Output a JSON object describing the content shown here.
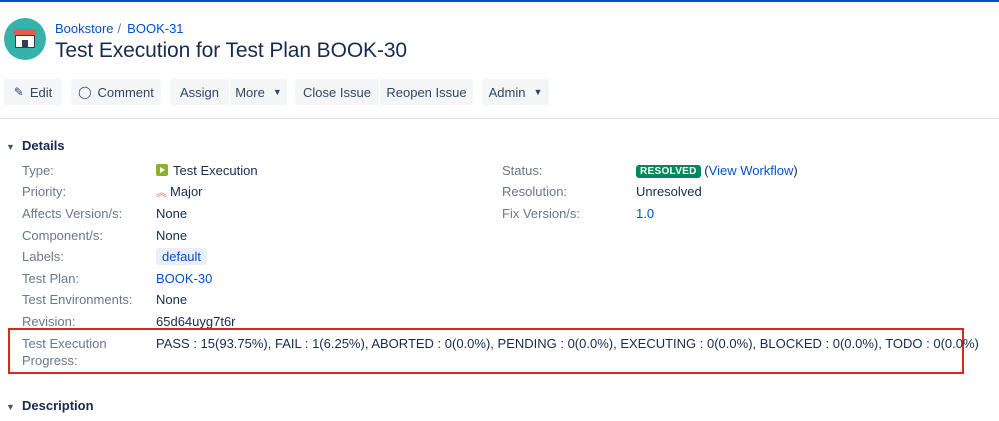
{
  "header": {
    "breadcrumb_project": "Bookstore",
    "breadcrumb_separator": "/",
    "breadcrumb_issue": "BOOK-31",
    "title": "Test Execution for Test Plan BOOK-30"
  },
  "toolbar": {
    "edit": "Edit",
    "comment": "Comment",
    "assign": "Assign",
    "more": "More",
    "close_issue": "Close Issue",
    "reopen_issue": "Reopen Issue",
    "admin": "Admin"
  },
  "details": {
    "heading": "Details",
    "left": [
      {
        "label": "Type:",
        "value": "Test Execution"
      },
      {
        "label": "Priority:",
        "value": "Major"
      },
      {
        "label": "Affects Version/s:",
        "value": "None"
      },
      {
        "label": "Component/s:",
        "value": "None"
      },
      {
        "label": "Labels:",
        "value": "default"
      },
      {
        "label": "Test Plan:",
        "value": "BOOK-30"
      },
      {
        "label": "Test Environments:",
        "value": "None"
      },
      {
        "label": "Revision:",
        "value": "65d64uyg7t6r"
      }
    ],
    "progress": {
      "label_line1": "Test Execution",
      "label_line2": "Progress:",
      "value": "PASS : 15(93.75%), FAIL : 1(6.25%), ABORTED : 0(0.0%), PENDING : 0(0.0%), EXECUTING : 0(0.0%), BLOCKED : 0(0.0%), TODO : 0(0.0%)"
    },
    "right": {
      "status_label": "Status:",
      "status_value": "RESOLVED",
      "view_workflow_open": "(",
      "view_workflow": "View Workflow",
      "view_workflow_close": ")",
      "resolution_label": "Resolution:",
      "resolution_value": "Unresolved",
      "fix_label": "Fix Version/s:",
      "fix_value": "1.0"
    }
  },
  "description": {
    "heading": "Description"
  },
  "colors": {
    "link": "#0052cc",
    "status_resolved": "#00875a",
    "highlight": "#e0261b"
  }
}
